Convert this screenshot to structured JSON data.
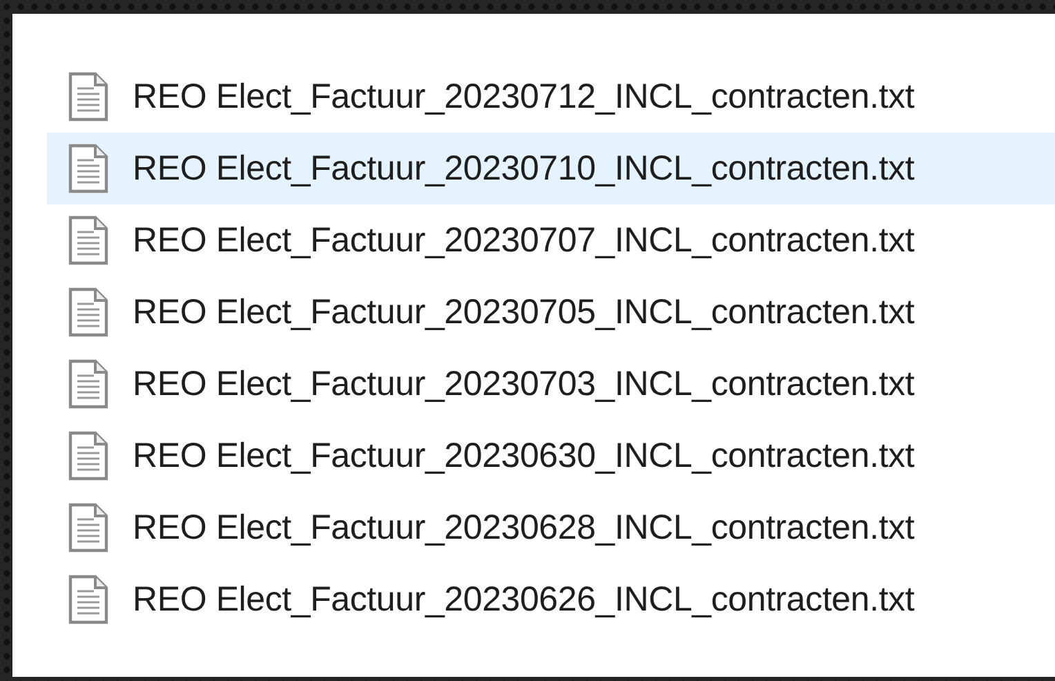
{
  "files": [
    {
      "name": "REO Elect_Factuur_20230712_INCL_contracten.txt",
      "selected": false
    },
    {
      "name": "REO Elect_Factuur_20230710_INCL_contracten.txt",
      "selected": true
    },
    {
      "name": "REO Elect_Factuur_20230707_INCL_contracten.txt",
      "selected": false
    },
    {
      "name": "REO Elect_Factuur_20230705_INCL_contracten.txt",
      "selected": false
    },
    {
      "name": "REO Elect_Factuur_20230703_INCL_contracten.txt",
      "selected": false
    },
    {
      "name": "REO Elect_Factuur_20230630_INCL_contracten.txt",
      "selected": false
    },
    {
      "name": "REO Elect_Factuur_20230628_INCL_contracten.txt",
      "selected": false
    },
    {
      "name": "REO Elect_Factuur_20230626_INCL_contracten.txt",
      "selected": false
    }
  ]
}
